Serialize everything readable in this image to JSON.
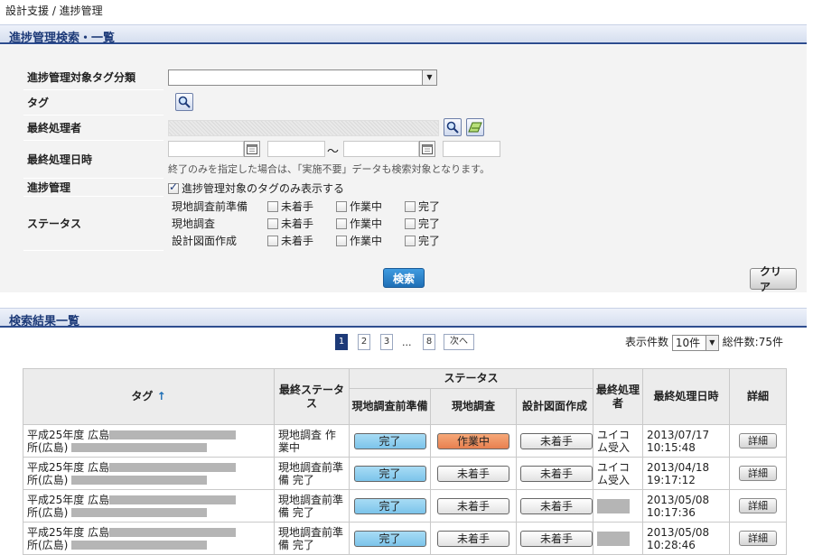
{
  "breadcrumb": "設計支援 / 進捗管理",
  "search_section": {
    "title": "進捗管理検索・一覧"
  },
  "form": {
    "tag_category_label": "進捗管理対象タグ分類",
    "tag_label": "タグ",
    "last_processor_label": "最終処理者",
    "last_processed_label": "最終処理日時",
    "range_separator": "〜",
    "date_hint": "終了のみを指定した場合は、「実施不要」データも検索対象となります。",
    "progress_label": "進捗管理",
    "progress_checkbox_label": "進捗管理対象のタグのみ表示する",
    "progress_checked": true,
    "status_label": "ステータス",
    "status_rows": [
      {
        "name": "現地調査前準備",
        "options": [
          "未着手",
          "作業中",
          "完了"
        ]
      },
      {
        "name": "現地調査",
        "options": [
          "未着手",
          "作業中",
          "完了"
        ]
      },
      {
        "name": "設計図面作成",
        "options": [
          "未着手",
          "作業中",
          "完了"
        ]
      }
    ],
    "search_button": "検索",
    "clear_button": "クリア"
  },
  "results_section": {
    "title": "検索結果一覧"
  },
  "pager": {
    "pages": [
      "1",
      "2",
      "3",
      "8"
    ],
    "ellipsis": "...",
    "next": "次へ",
    "current": "1"
  },
  "per_page": {
    "label": "表示件数",
    "value": "10件",
    "total": "総件数:75件"
  },
  "table": {
    "headers": {
      "tag": "タグ",
      "sort_icon": "↑",
      "last_status": "最終ステータス",
      "status_group": "ステータス",
      "col1": "現地調査前準備",
      "col2": "現地調査",
      "col3": "設計図面作成",
      "last_processor": "最終処理者",
      "last_processed": "最終処理日時",
      "detail": "詳細"
    },
    "rows": [
      {
        "tag_line1": "平成25年度 広島",
        "tag_line2": "所(広島)",
        "last_status": "現地調査 作業中",
        "s1": "完了",
        "s2": "作業中",
        "s3": "未着手",
        "processor": "ユイコム受入",
        "date": "2013/07/17",
        "time": "10:15:48",
        "detail": "詳細"
      },
      {
        "tag_line1": "平成25年度 広島",
        "tag_line2": "所(広島)",
        "last_status": "現地調査前準備 完了",
        "s1": "完了",
        "s2": "未着手",
        "s3": "未着手",
        "processor": "ユイコム受入",
        "date": "2013/04/18",
        "time": "19:17:12",
        "detail": "詳細"
      },
      {
        "tag_line1": "平成25年度 広島",
        "tag_line2": "所(広島)",
        "last_status": "現地調査前準備 完了",
        "s1": "完了",
        "s2": "未着手",
        "s3": "未着手",
        "processor": "",
        "date": "2013/05/08",
        "time": "10:17:36",
        "detail": "詳細"
      },
      {
        "tag_line1": "平成25年度 広島",
        "tag_line2": "所(広島)",
        "last_status": "現地調査前準備 完了",
        "s1": "完了",
        "s2": "未着手",
        "s3": "未着手",
        "processor": "",
        "date": "2013/05/08",
        "time": "10:28:46",
        "detail": "詳細"
      }
    ]
  },
  "colors": {
    "accent": "#1d3a78",
    "done": "#7cc4ea",
    "wip": "#e88050",
    "not_started": "#e2e2e2"
  }
}
